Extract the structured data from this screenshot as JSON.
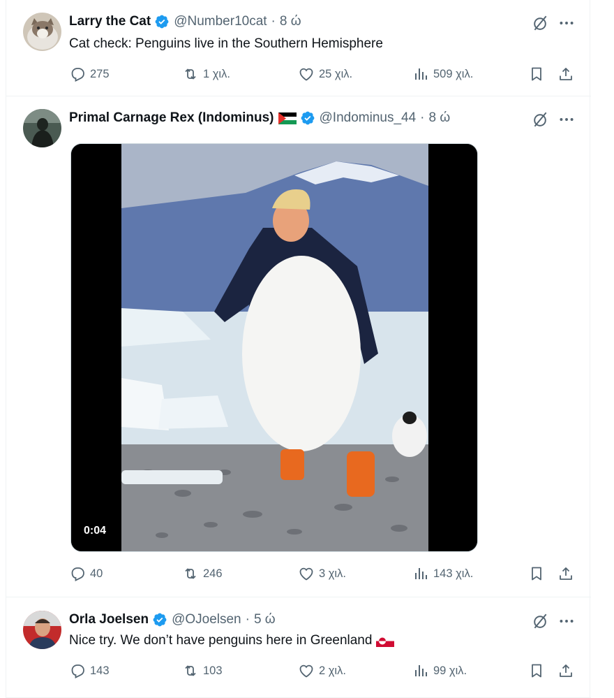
{
  "tweets": [
    {
      "name": "Larry the Cat",
      "handle": "@Number10cat",
      "dot": "·",
      "time": "8 ώ",
      "text": "Cat check: Penguins live in the Southern Hemisphere",
      "replies": "275",
      "retweets": "1 χιλ.",
      "likes": "25 χιλ.",
      "views": "509 χιλ."
    },
    {
      "name": "Primal Carnage Rex (Indominus)",
      "handle": "@Indominus_44",
      "dot": "·",
      "time": "8 ώ",
      "video_duration": "0:04",
      "replies": "40",
      "retweets": "246",
      "likes": "3 χιλ.",
      "views": "143 χιλ."
    },
    {
      "name": "Orla Joelsen",
      "handle": "@OJoelsen",
      "dot": "·",
      "time": "5 ώ",
      "text": "Nice try. We don’t have penguins here in Greenland",
      "replies": "143",
      "retweets": "103",
      "likes": "2 χιλ.",
      "views": "99 χιλ."
    }
  ],
  "icons": {
    "verified": "verified-badge-icon",
    "grok": "grok-icon",
    "more": "more-icon",
    "reply": "reply-icon",
    "retweet": "retweet-icon",
    "like": "heart-icon",
    "views": "views-icon",
    "bookmark": "bookmark-icon",
    "share": "share-icon"
  },
  "colors": {
    "verified": "#1d9bf0",
    "text": "#0f1419",
    "secondary": "#536471",
    "border": "#eff3f4"
  }
}
